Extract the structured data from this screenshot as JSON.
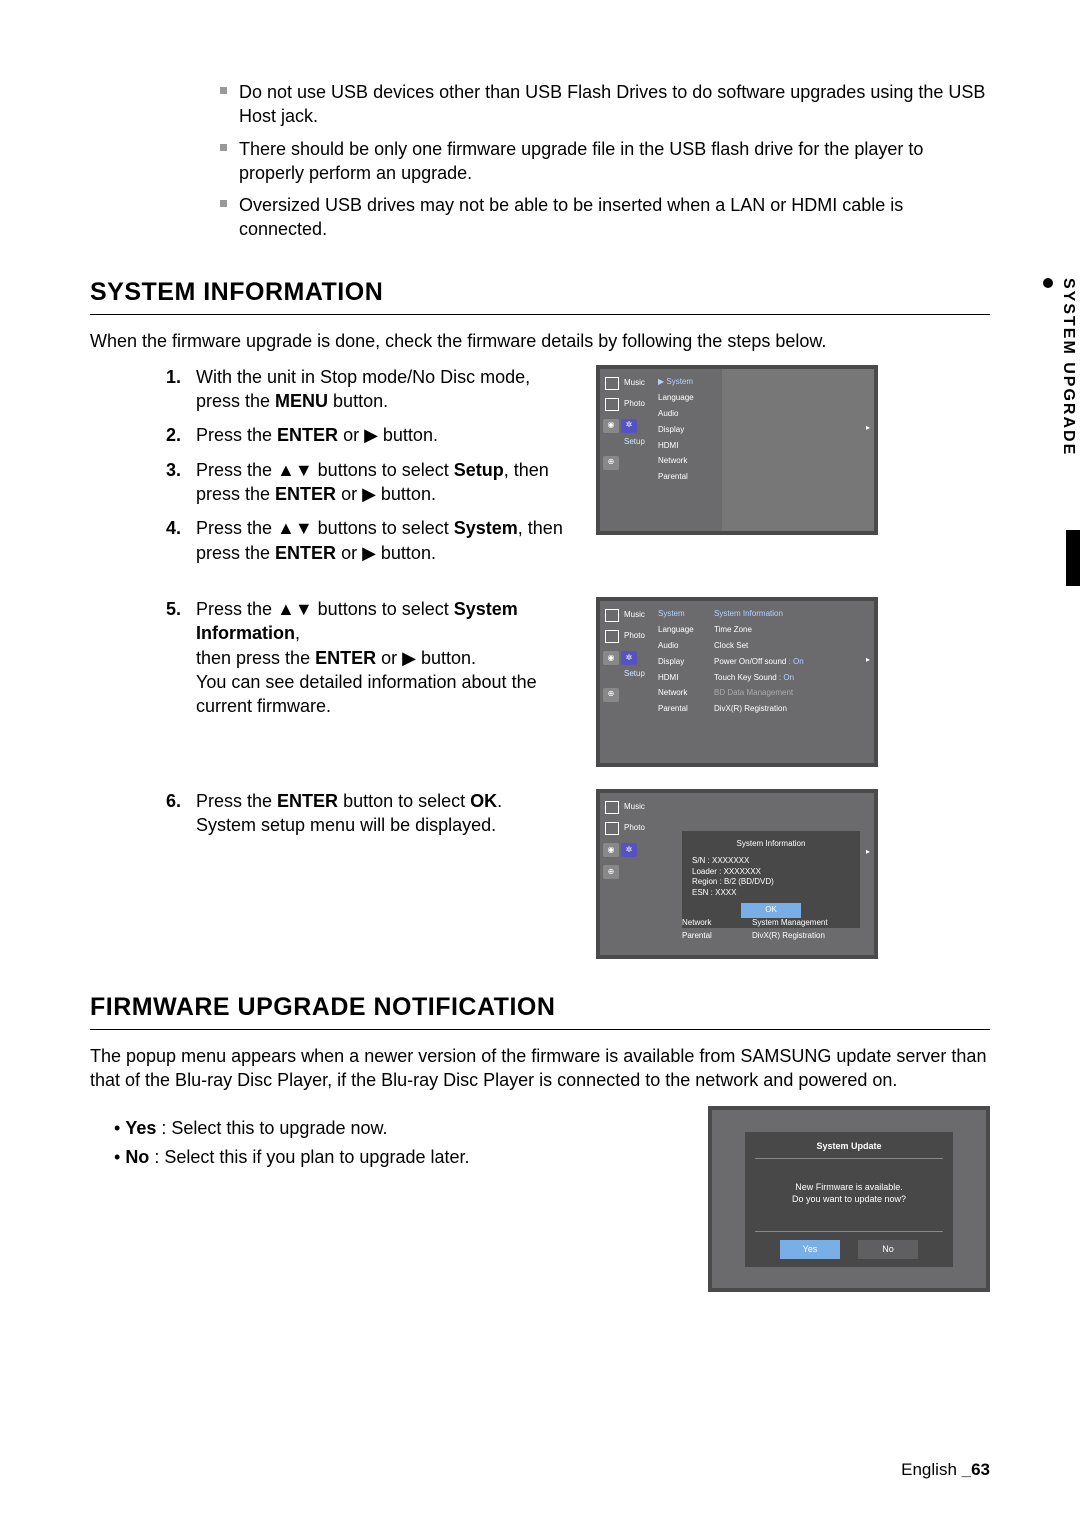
{
  "side_tab": "SYSTEM UPGRADE",
  "warnings": [
    "Do not use USB devices other than USB Flash Drives to do software upgrades using the USB Host jack.",
    "There should be only one firmware upgrade file in the USB flash drive for the player to properly perform an upgrade.",
    "Oversized USB drives may not be able to be inserted when a LAN or HDMI cable is connected."
  ],
  "sysinfo": {
    "heading": "SYSTEM INFORMATION",
    "intro": "When the firmware upgrade is done, check the firmware details by following the steps below.",
    "steps14": [
      {
        "pre": "With the unit in Stop mode/No Disc mode, press the ",
        "bold": "MENU",
        "post": " button."
      },
      {
        "pre": "Press the ",
        "bold": "ENTER",
        "post": " or ▶ button."
      },
      {
        "pre": "Press the ▲▼ buttons to select ",
        "bold": "Setup",
        "post2": ", then press the ",
        "bold2": "ENTER",
        "post3": " or ▶ button."
      },
      {
        "pre": "Press the ▲▼ buttons to select ",
        "bold": "System",
        "post2": ", then press the ",
        "bold2": "ENTER",
        "post3": " or ▶ button."
      }
    ],
    "step5": {
      "line1_pre": "Press the ▲▼ buttons to select ",
      "line1_bold": "System Information",
      "line1_post": ",",
      "line2_pre": "then press the ",
      "line2_bold": "ENTER",
      "line2_post": " or ▶ button.",
      "line3": "You can see detailed information about the current firmware."
    },
    "step6": {
      "line1_pre": "Press the ",
      "line1_bold": "ENTER",
      "line1_mid": " button to select ",
      "line1_bold2": "OK",
      "line1_post": ".",
      "line2": "System setup menu will be displayed."
    }
  },
  "osd": {
    "left_items": [
      "Music",
      "Photo",
      "Setup"
    ],
    "setup_items_col1": [
      "▶ System",
      "Language",
      "Audio",
      "Display",
      "HDMI",
      "Network",
      "Parental"
    ],
    "setup_items_col1b": [
      "System",
      "Language",
      "Audio",
      "Display",
      "HDMI",
      "Network",
      "Parental"
    ],
    "system_items_col2": [
      "System Information",
      "Time Zone",
      "Clock Set",
      "Power On/Off sound",
      "Touch Key Sound",
      "BD Data Management",
      "DivX(R) Registration"
    ],
    "system_vals": {
      "Power On/Off sound": ": On",
      "Touch Key Sound": ": On"
    },
    "sysinfo_panel": {
      "title": "System Information",
      "lines": [
        "S/N : XXXXXXX",
        "Loader : XXXXXXX",
        "Region : B/2 (BD/DVD)",
        "ESN : XXXX"
      ],
      "ok": "OK"
    },
    "below_list": [
      {
        "l": "Network",
        "r": "System Management",
        "dim": true
      },
      {
        "l": "Parental",
        "r": "DivX(R) Registration"
      }
    ]
  },
  "firmware": {
    "heading": "FIRMWARE UPGRADE NOTIFICATION",
    "intro": "The popup menu appears when a newer version of the firmware is available from SAMSUNG update server than that of the Blu-ray Disc Player, if the Blu-ray Disc Player is connected to the network and powered on.",
    "bullets": [
      {
        "bold": "Yes",
        "text": " : Select this to upgrade now."
      },
      {
        "bold": "No",
        "text": " : Select this if you plan to upgrade later."
      }
    ],
    "popup": {
      "title": "System Update",
      "line1": "New Firmware is available.",
      "line2": "Do you want to update now?",
      "yes": "Yes",
      "no": "No"
    }
  },
  "footer": {
    "lang": "English ",
    "page": "_63"
  }
}
